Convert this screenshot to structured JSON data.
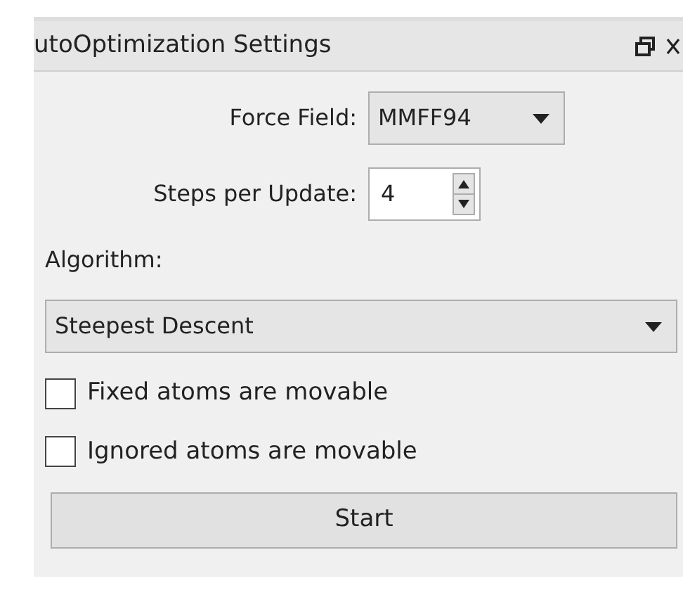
{
  "window": {
    "title": "utoOptimization Settings"
  },
  "force_field": {
    "label": "Force Field:",
    "value": "MMFF94"
  },
  "steps": {
    "label": "Steps per Update:",
    "value": "4"
  },
  "algorithm": {
    "label": "Algorithm:",
    "value": "Steepest Descent"
  },
  "options": [
    {
      "label": "Fixed atoms are movable",
      "checked": false
    },
    {
      "label": "Ignored atoms are movable",
      "checked": false
    }
  ],
  "buttons": [
    "Start"
  ]
}
